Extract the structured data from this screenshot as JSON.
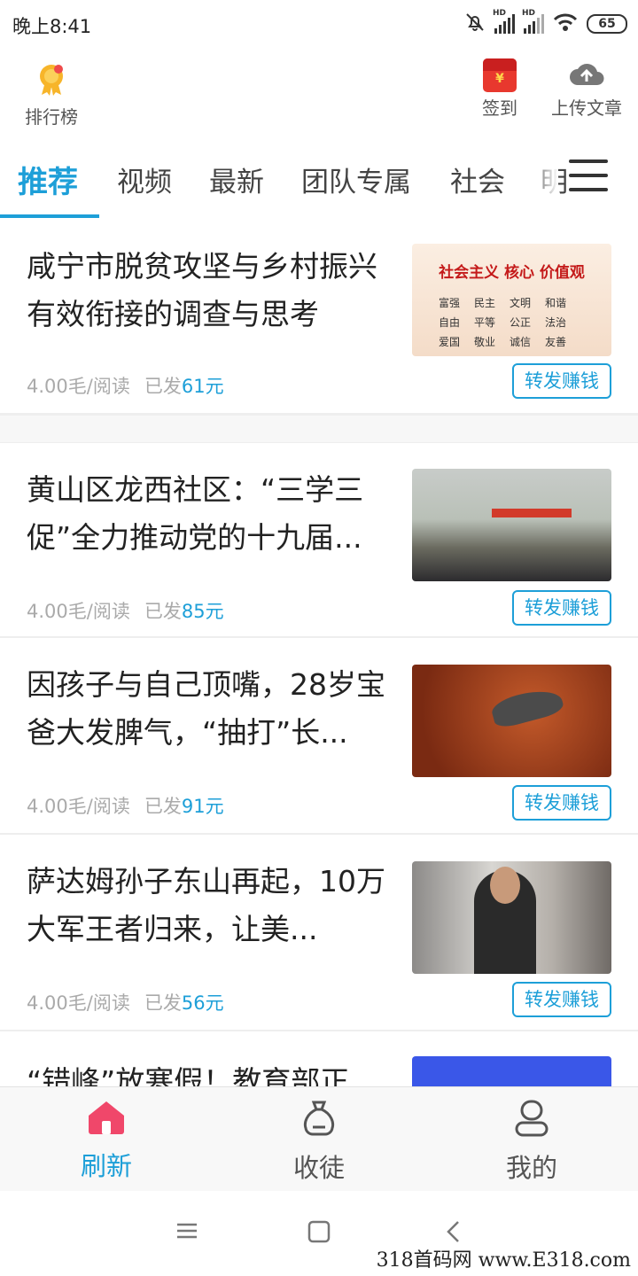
{
  "status_bar": {
    "time": "晚上8:41",
    "battery": "65",
    "signal_label": "HD"
  },
  "header": {
    "rank_label": "排行榜",
    "signin_label": "签到",
    "upload_label": "上传文章",
    "redbag_symbol": "¥"
  },
  "tabs": [
    {
      "label": "推荐",
      "active": true
    },
    {
      "label": "视频"
    },
    {
      "label": "最新"
    },
    {
      "label": "团队专属"
    },
    {
      "label": "社会"
    },
    {
      "label": "明"
    }
  ],
  "articles": [
    {
      "title": "咸宁市脱贫攻坚与乡村振兴有效衔接的调查与思考",
      "rate": "4.00毛/阅读",
      "sent_prefix": "已发",
      "amount": "61元",
      "action": "转发赚钱",
      "thumb_text": {
        "top": "社会主义 核心 价值观",
        "words": [
          "富强",
          "民主",
          "文明",
          "和谐",
          "自由",
          "平等",
          "公正",
          "法治",
          "爱国",
          "敬业",
          "诚信",
          "友善"
        ]
      }
    },
    {
      "title": "黄山区龙西社区：“三学三促”全力推动党的十九届...",
      "rate": "4.00毛/阅读",
      "sent_prefix": "已发",
      "amount": "85元",
      "action": "转发赚钱"
    },
    {
      "title": "因孩子与自己顶嘴，28岁宝爸大发脾气，“抽打”长...",
      "rate": "4.00毛/阅读",
      "sent_prefix": "已发",
      "amount": "91元",
      "action": "转发赚钱"
    },
    {
      "title": "萨达姆孙子东山再起，10万大军王者归来，让美...",
      "rate": "4.00毛/阅读",
      "sent_prefix": "已发",
      "amount": "56元",
      "action": "转发赚钱"
    },
    {
      "title": "“错峰”放寒假！教育部正"
    }
  ],
  "bottom_nav": [
    {
      "label": "刷新",
      "active": true
    },
    {
      "label": "收徒"
    },
    {
      "label": "我的"
    }
  ],
  "watermark": "318首码网 www.E318.com",
  "colors": {
    "accent": "#1d9fd8",
    "nav_active_icon": "#f0476a"
  }
}
